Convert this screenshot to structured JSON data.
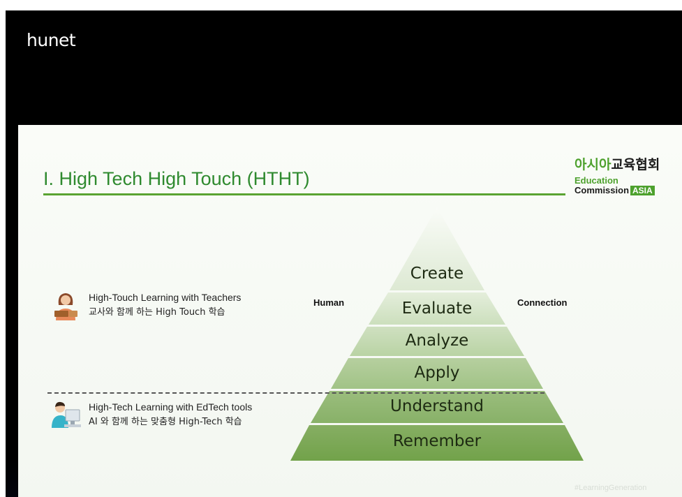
{
  "header": {
    "logo_text": "hunet"
  },
  "slide": {
    "title": "I. High Tech High Touch (HTHT)",
    "org": {
      "korean_prefix": "아시아",
      "korean_suffix": "교육협회",
      "line1": "Education",
      "line2": "Commission",
      "badge": "ASIA"
    },
    "pyramid": {
      "levels": [
        "Create",
        "Evaluate",
        "Analyze",
        "Apply",
        "Understand",
        "Remember"
      ],
      "left_label": "Human",
      "right_label": "Connection"
    },
    "high_touch": {
      "line1": "High-Touch Learning with Teachers",
      "line2": "교사와 함께 하는 High Touch 학습"
    },
    "high_tech": {
      "line1": "High-Tech Learning with EdTech tools",
      "line2": "AI 와 함께 하는 맞춤형 High-Tech 학습"
    },
    "watermark": "#LearningGeneration"
  },
  "colors": {
    "accent_green": "#4da12d",
    "title_green": "#2f8a2f",
    "pyramid_dark": "#72a24a",
    "pyramid_light": "#f2f6ee"
  }
}
